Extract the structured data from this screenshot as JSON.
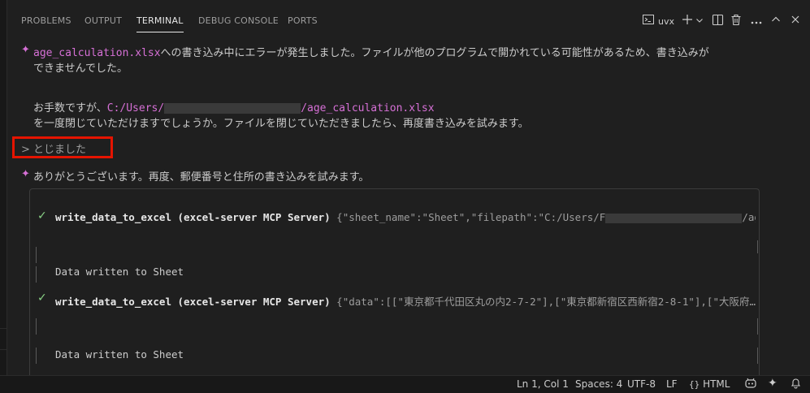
{
  "panel": {
    "tabs": [
      {
        "label": "PROBLEMS"
      },
      {
        "label": "OUTPUT"
      },
      {
        "label": "TERMINAL"
      },
      {
        "label": "DEBUG CONSOLE"
      },
      {
        "label": "PORTS"
      }
    ],
    "active_tab": "TERMINAL",
    "terminal_name": "uvx"
  },
  "messages": {
    "m1_file": "age_calculation.xlsx",
    "m1_rest": "への書き込み中にエラーが発生しました。ファイルが他のプログラムで開かれている可能性があるため、書き込みが",
    "m1_line2": "できませんでした。",
    "m2_prefix": "お手数ですが、",
    "m2_path_start": "C:/Users/",
    "m2_path_end": "/age_calculation.xlsx",
    "m2_line2": "を一度閉じていただけますでしょうか。ファイルを閉じていただきましたら、再度書き込みを試みます。",
    "user_prompt_symbol": ">",
    "user_reply": "とじました",
    "m3": "ありがとうございます。再度、郵便番号と住所の書き込みを試みます。"
  },
  "tool_calls": [
    {
      "check": "✓",
      "name": "write_data_to_excel (excel-server MCP Server)",
      "args_start": " {\"sheet_name\":\"Sheet\",\"filepath\":\"C:/Users/F",
      "args_end": "/age_cal…",
      "result": "Data written to Sheet"
    },
    {
      "check": "✓",
      "name": "write_data_to_excel (excel-server MCP Server)",
      "args_start": " {\"data\":[[\"東京都千代田区丸の内2-7-2\"],[\"東京都新宿区西新宿2-8-1\"],[\"大阪府…",
      "args_end": "",
      "result": "Data written to Sheet"
    }
  ],
  "statusbar": {
    "position": "Ln 1, Col 1",
    "spaces": "Spaces: 4",
    "encoding": "UTF-8",
    "eol": "LF",
    "language": "HTML"
  },
  "colors": {
    "background": "#1f1f1f",
    "accent_magenta": "#d670d6",
    "check_green": "#89d185",
    "highlight_red": "#e51400"
  },
  "icons": {
    "spark": "sparkle-icon",
    "terminal": "terminal-icon",
    "add": "plus-icon",
    "split": "split-icon",
    "trash": "trash-icon",
    "more": "ellipsis-icon",
    "maximize": "chevron-up-icon",
    "close": "close-icon"
  }
}
